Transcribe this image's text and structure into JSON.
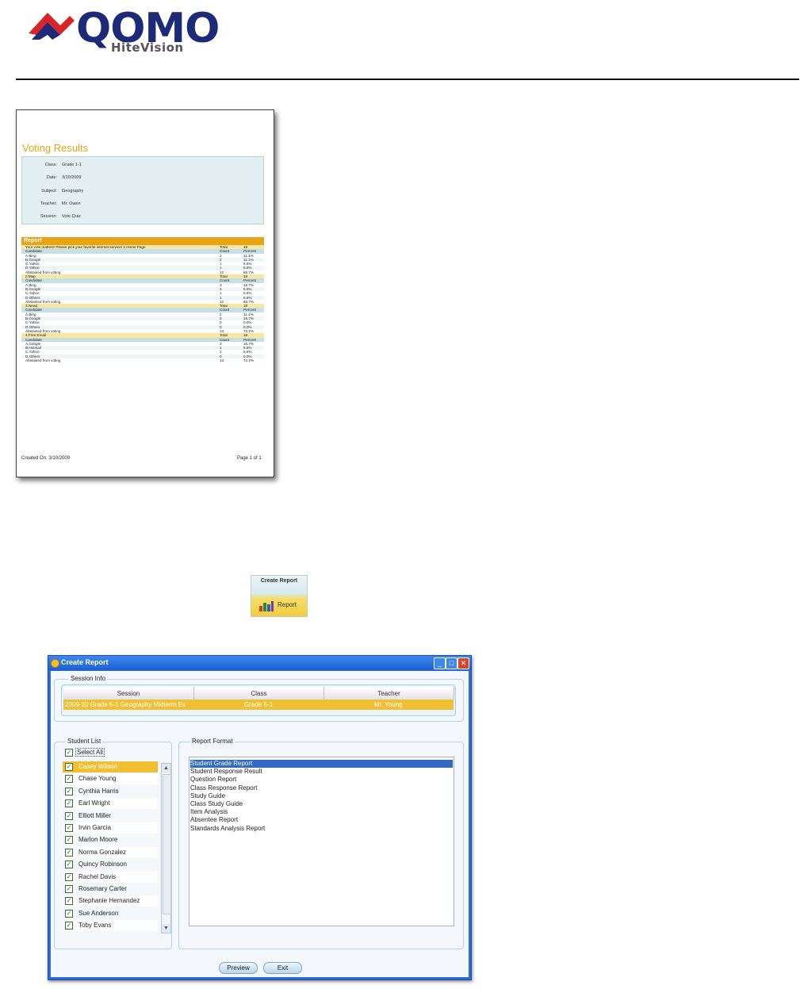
{
  "logo": {
    "wordmark": "QOMO",
    "submark": "HiteVision"
  },
  "report_preview": {
    "title": "Voting Results",
    "info": [
      {
        "label": "Class:",
        "value": "Grade 1-1"
      },
      {
        "label": "Date:",
        "value": "3/10/2009"
      },
      {
        "label": "Subject:",
        "value": "Geography"
      },
      {
        "label": "Teacher:",
        "value": "Mr. Owen"
      },
      {
        "label": "Session:",
        "value": "Vote Quiz"
      }
    ],
    "section_title": "Report",
    "rows": [
      {
        "kind": "q",
        "c1": "Your vote matters! Please pick your favorite internet service/ 1.Home Page",
        "c2": "Total",
        "c3": "18"
      },
      {
        "kind": "h",
        "c1": "Candidate",
        "c2": "Count",
        "c3": "Percent"
      },
      {
        "kind": "d",
        "c1": "A.Bing",
        "c2": "2",
        "c3": "11.1%"
      },
      {
        "kind": "d",
        "c1": "B.Google",
        "c2": "2",
        "c3": "11.1%"
      },
      {
        "kind": "d",
        "c1": "C.Yahoo",
        "c2": "1",
        "c3": "5.6%"
      },
      {
        "kind": "d",
        "c1": "D.Yahoo",
        "c2": "1",
        "c3": "5.6%"
      },
      {
        "kind": "d",
        "c1": "Abstained from voting",
        "c2": "12",
        "c3": "66.7%"
      },
      {
        "kind": "q",
        "c1": "2.Map",
        "c2": "Total",
        "c3": "18"
      },
      {
        "kind": "h",
        "c1": "Candidate",
        "c2": "Count",
        "c3": "Percent"
      },
      {
        "kind": "d",
        "c1": "A.Bing",
        "c2": "3",
        "c3": "16.7%"
      },
      {
        "kind": "d",
        "c1": "B.Google",
        "c2": "1",
        "c3": "5.6%"
      },
      {
        "kind": "d",
        "c1": "C.Yahoo",
        "c2": "1",
        "c3": "5.6%"
      },
      {
        "kind": "d",
        "c1": "D.Others",
        "c2": "1",
        "c3": "5.6%"
      },
      {
        "kind": "d",
        "c1": "Abstained from voting",
        "c2": "12",
        "c3": "66.7%"
      },
      {
        "kind": "q",
        "c1": "3.News",
        "c2": "Total",
        "c3": "18"
      },
      {
        "kind": "h",
        "c1": "Candidate",
        "c2": "Count",
        "c3": "Percent"
      },
      {
        "kind": "d",
        "c1": "A.Bing",
        "c2": "2",
        "c3": "11.1%"
      },
      {
        "kind": "d",
        "c1": "B.Google",
        "c2": "3",
        "c3": "16.7%"
      },
      {
        "kind": "d",
        "c1": "C.Yahoo",
        "c2": "0",
        "c3": "0.0%"
      },
      {
        "kind": "d",
        "c1": "D.Others",
        "c2": "0",
        "c3": "0.0%"
      },
      {
        "kind": "d",
        "c1": "Abstained from voting",
        "c2": "13",
        "c3": "72.2%"
      },
      {
        "kind": "q",
        "c1": "4.Free Email",
        "c2": "Total",
        "c3": "18"
      },
      {
        "kind": "h",
        "c1": "Candidate",
        "c2": "Count",
        "c3": "Percent"
      },
      {
        "kind": "d",
        "c1": "A.Google",
        "c2": "3",
        "c3": "16.7%"
      },
      {
        "kind": "d",
        "c1": "B.Hotmail",
        "c2": "1",
        "c3": "5.6%"
      },
      {
        "kind": "d",
        "c1": "C.Yahoo",
        "c2": "1",
        "c3": "5.6%"
      },
      {
        "kind": "d",
        "c1": "D.Others",
        "c2": "0",
        "c3": "0.0%"
      },
      {
        "kind": "d",
        "c1": "Abstained from voting",
        "c2": "13",
        "c3": "72.2%"
      }
    ],
    "footer_left": "Created On: 3/10/2009",
    "footer_right": "Page 1 of 1"
  },
  "create_report_button": {
    "title": "Create Report",
    "label": "Report"
  },
  "dialog": {
    "title": "Create Report",
    "session_info_label": "Session Info",
    "session_headers": [
      "Session",
      "Class",
      "Teacher"
    ],
    "session_row": [
      "2009-10 Grade 5-1 Geography Midterm Ex",
      "Grade 5-1",
      "Mr. Young"
    ],
    "student_list_label": "Student List",
    "select_all_label": "Select All",
    "students": [
      "Casey Wilson",
      "Chase Young",
      "Cynthia Harris",
      "Earl Wright",
      "Elliott Miller",
      "Irvin Garcia",
      "Marlon Moore",
      "Norma Gonzalez",
      "Quincy Robinson",
      "Rachel Davis",
      "Rosemary Carter",
      "Stephanie Hernandez",
      "Sue Anderson",
      "Toby Evans"
    ],
    "report_format_label": "Report Format",
    "formats": [
      "Student Grade Report",
      "Student Response Result",
      "Question Report",
      "Class Response Report",
      "Study Guide",
      "Class Study Guide",
      "Item Analysis",
      "Absentee Report",
      "Standards Analysis Report"
    ],
    "preview_label": "Preview",
    "exit_label": "Exit"
  }
}
